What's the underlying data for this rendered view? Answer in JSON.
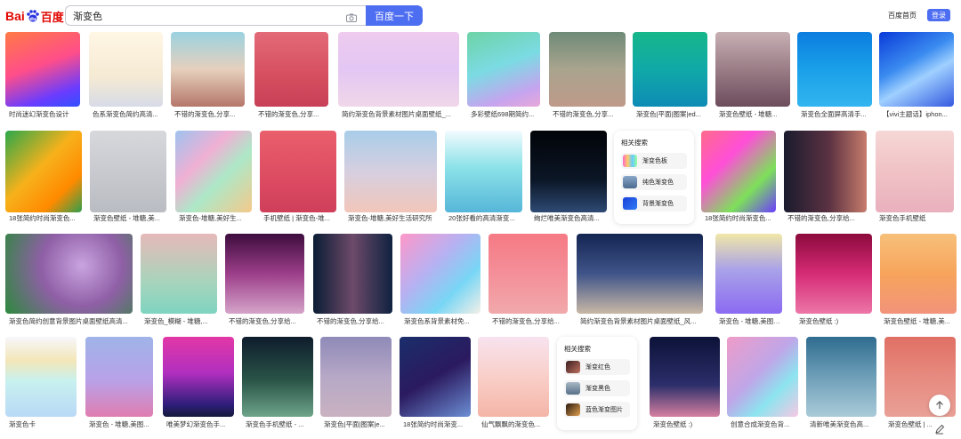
{
  "header": {
    "logo_text_left": "Bai",
    "logo_text_right": "百度",
    "search_value": "渐变色",
    "search_button": "百度一下",
    "home_link": "百度首页",
    "login_button": "登录",
    "accent": "#4e6ef2"
  },
  "rows": [
    [
      {
        "caption": "时尚迷幻渐变色设计"
      },
      {
        "caption": "色系渐变色简约高清..."
      },
      {
        "caption": "不错的渐变色,分享..."
      },
      {
        "caption": "不错的渐变色,分享..."
      },
      {
        "caption": "简约渐变色背景素材图片桌面壁纸_..."
      },
      {
        "caption": "多彩壁纸698期简约..."
      },
      {
        "caption": "不错的渐变色,分享..."
      },
      {
        "caption": "渐变色|平面|图案|ed..."
      },
      {
        "caption": "渐变色壁纸 - 堆糖..."
      },
      {
        "caption": "渐变色全面屏高清手..."
      },
      {
        "caption": "【vivi主题话】iphon..."
      }
    ],
    [
      {
        "caption": "18张简约时尚渐变色..."
      },
      {
        "caption": "渐变色壁纸 - 堆糖,美..."
      },
      {
        "caption": "渐变色-堆糖,美好生..."
      },
      {
        "caption": "手机壁纸 | 渐变色-堆..."
      },
      {
        "caption": "渐变色-堆糖,美好生活研究所"
      },
      {
        "caption": "20张好看的高清渐变..."
      },
      {
        "caption": "绚烂唯美渐变色高清..."
      },
      {
        "caption": "18张简约时尚渐变色..."
      },
      {
        "caption": "不错的渐变色,分享给..."
      },
      {
        "caption": "渐变色手机壁纸"
      }
    ],
    [
      {
        "caption": "渐变色简约创意背景图片桌面壁纸高清..."
      },
      {
        "caption": "渐变色_模糊 - 堆糖,..."
      },
      {
        "caption": "不错的渐变色,分享给..."
      },
      {
        "caption": "不错的渐变色,分享给..."
      },
      {
        "caption": "渐变色系背景素材免..."
      },
      {
        "caption": "不错的渐变色,分享给..."
      },
      {
        "caption": "简约渐变色背景素材图片桌面壁纸_风..."
      },
      {
        "caption": "渐变色 - 堆糖,美图壁..."
      },
      {
        "caption": "渐变色壁纸 :)"
      },
      {
        "caption": "渐变色壁纸 - 堆糖,美..."
      }
    ],
    [
      {
        "caption": "渐变色卡"
      },
      {
        "caption": "渐变色 - 堆糖,美图..."
      },
      {
        "caption": "唯美梦幻渐变色手..."
      },
      {
        "caption": "渐变色手机壁纸 - ..."
      },
      {
        "caption": "渐变色|平面|图案|e..."
      },
      {
        "caption": "18张简约时尚渐变..."
      },
      {
        "caption": "仙气飘飘的渐变色..."
      },
      {
        "caption": "渐变色壁纸 :)"
      },
      {
        "caption": "创意合成渐变色背..."
      },
      {
        "caption": "清新唯美渐变色高..."
      },
      {
        "caption": "渐变色壁纸 | ..."
      }
    ]
  ],
  "related1": {
    "title": "相关搜索",
    "items": [
      {
        "label": "渐变色板"
      },
      {
        "label": "纯色渐变色"
      },
      {
        "label": "背景渐变色"
      }
    ]
  },
  "related2": {
    "title": "相关搜索",
    "items": [
      {
        "label": "渐变红色"
      },
      {
        "label": "渐变黑色"
      },
      {
        "label": "蓝色渐变图片"
      }
    ]
  }
}
